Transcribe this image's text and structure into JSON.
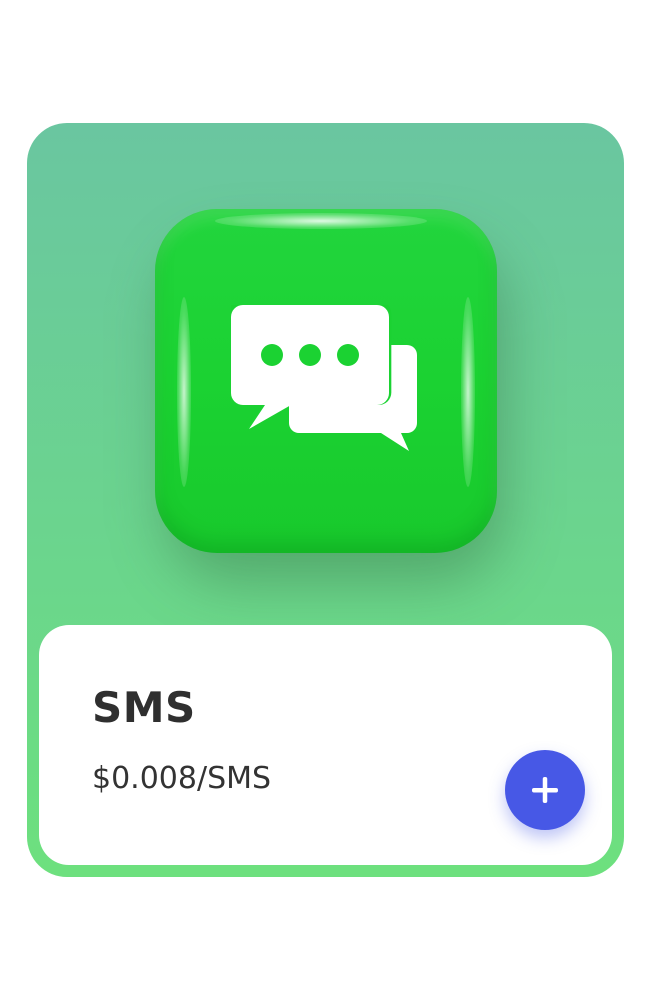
{
  "product": {
    "name": "SMS",
    "price": "$0.008/SMS",
    "icon": "chat-bubbles-icon"
  },
  "actions": {
    "add_icon": "plus-icon"
  },
  "colors": {
    "card_gradient_top": "#6ac6a0",
    "card_gradient_bottom": "#6de07e",
    "icon_tile": "#1bd232",
    "add_button": "#4758e6",
    "title_text": "#2f2f2f"
  }
}
